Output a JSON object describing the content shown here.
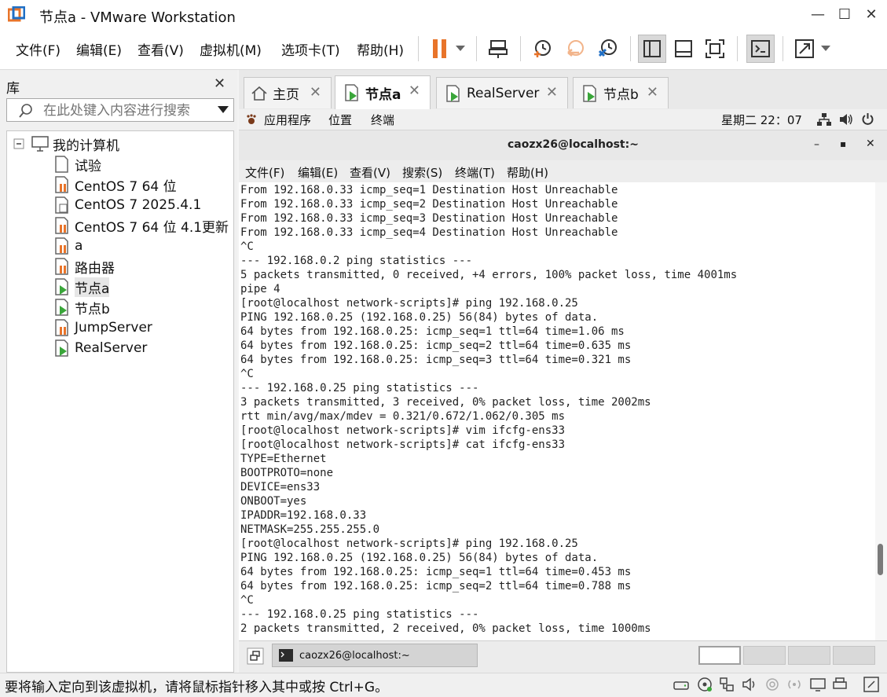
{
  "window": {
    "title": "节点a - VMware Workstation",
    "controls": {
      "minimize": "—",
      "maximize": "☐",
      "close": "✕"
    }
  },
  "menubar": {
    "items": [
      "文件(F)",
      "编辑(E)",
      "查看(V)",
      "虚拟机(M)",
      "选项卡(T)",
      "帮助(H)"
    ]
  },
  "library": {
    "title": "库",
    "close": "✕",
    "search_placeholder": "在此处键入内容进行搜索",
    "root": "我的计算机",
    "items": [
      "试验",
      "CentOS 7 64 位",
      "CentOS 7 2025.4.1",
      "CentOS 7 64 位 4.1更新",
      "a",
      "路由器",
      "节点a",
      "节点b",
      "JumpServer",
      "RealServer"
    ]
  },
  "tabs": [
    {
      "label": "主页",
      "close": "✕"
    },
    {
      "label": "节点a",
      "close": "✕"
    },
    {
      "label": "RealServer",
      "close": "✕"
    },
    {
      "label": "节点b",
      "close": "✕"
    }
  ],
  "gnome_panel": {
    "apps": "应用程序",
    "places": "位置",
    "terminal": "终端",
    "clock": "星期二 22：07"
  },
  "terminal": {
    "title": "caozx26@localhost:~",
    "controls": {
      "minimize": "–",
      "maximize": "▪",
      "close": "✕"
    },
    "menu": [
      "文件(F)",
      "编辑(E)",
      "查看(V)",
      "搜索(S)",
      "终端(T)",
      "帮助(H)"
    ],
    "output": "From 192.168.0.33 icmp_seq=1 Destination Host Unreachable\nFrom 192.168.0.33 icmp_seq=2 Destination Host Unreachable\nFrom 192.168.0.33 icmp_seq=3 Destination Host Unreachable\nFrom 192.168.0.33 icmp_seq=4 Destination Host Unreachable\n^C\n--- 192.168.0.2 ping statistics ---\n5 packets transmitted, 0 received, +4 errors, 100% packet loss, time 4001ms\npipe 4\n[root@localhost network-scripts]# ping 192.168.0.25\nPING 192.168.0.25 (192.168.0.25) 56(84) bytes of data.\n64 bytes from 192.168.0.25: icmp_seq=1 ttl=64 time=1.06 ms\n64 bytes from 192.168.0.25: icmp_seq=2 ttl=64 time=0.635 ms\n64 bytes from 192.168.0.25: icmp_seq=3 ttl=64 time=0.321 ms\n^C\n--- 192.168.0.25 ping statistics ---\n3 packets transmitted, 3 received, 0% packet loss, time 2002ms\nrtt min/avg/max/mdev = 0.321/0.672/1.062/0.305 ms\n[root@localhost network-scripts]# vim ifcfg-ens33\n[root@localhost network-scripts]# cat ifcfg-ens33\nTYPE=Ethernet\nBOOTPROTO=none\nDEVICE=ens33\nONBOOT=yes\nIPADDR=192.168.0.33\nNETMASK=255.255.255.0\n[root@localhost network-scripts]# ping 192.168.0.25\nPING 192.168.0.25 (192.168.0.25) 56(84) bytes of data.\n64 bytes from 192.168.0.25: icmp_seq=1 ttl=64 time=0.453 ms\n64 bytes from 192.168.0.25: icmp_seq=2 ttl=64 time=0.788 ms\n^C\n--- 192.168.0.25 ping statistics ---\n2 packets transmitted, 2 received, 0% packet loss, time 1000ms"
  },
  "taskbar": {
    "item": "caozx26@localhost:~"
  },
  "statusbar": {
    "text": "要将输入定向到该虚拟机，请将鼠标指针移入其中或按 Ctrl+G。"
  },
  "colors": {
    "accent_orange": "#e8742a",
    "vm_running_green": "#3aa63a",
    "vmware_blue": "#1f6fc5"
  }
}
